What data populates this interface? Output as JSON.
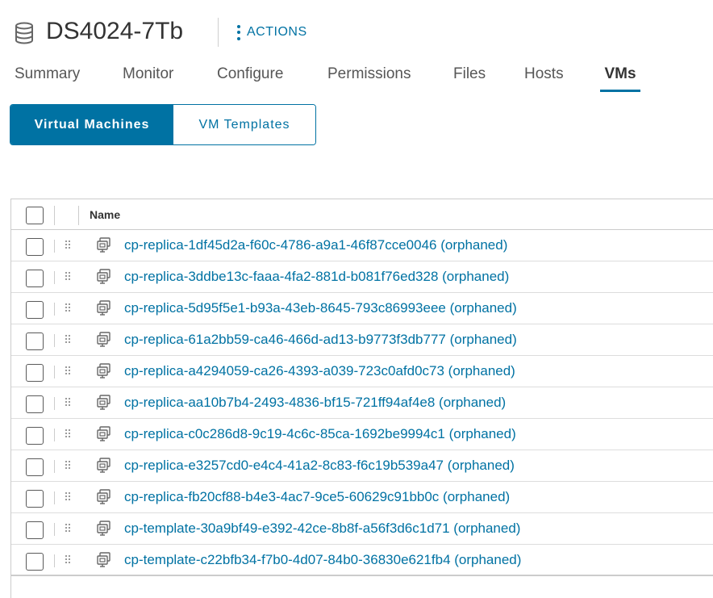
{
  "header": {
    "icon": "database-icon",
    "title": "DS4024-7Tb",
    "actions_icon": "kebab-icon",
    "actions_label": "ACTIONS"
  },
  "tabs": [
    {
      "label": "Summary",
      "active": false
    },
    {
      "label": "Monitor",
      "active": false
    },
    {
      "label": "Configure",
      "active": false
    },
    {
      "label": "Permissions",
      "active": false
    },
    {
      "label": "Files",
      "active": false
    },
    {
      "label": "Hosts",
      "active": false
    },
    {
      "label": "VMs",
      "active": true
    }
  ],
  "view_toggle": {
    "options": [
      "Virtual Machines",
      "VM Templates"
    ],
    "selected": "Virtual Machines"
  },
  "grid": {
    "columns": [
      "Name"
    ],
    "row_icon": "vm-icon",
    "rows": [
      {
        "name": "cp-replica-1df45d2a-f60c-4786-a9a1-46f87cce0046 (orphaned)"
      },
      {
        "name": "cp-replica-3ddbe13c-faaa-4fa2-881d-b081f76ed328 (orphaned)"
      },
      {
        "name": "cp-replica-5d95f5e1-b93a-43eb-8645-793c86993eee (orphaned)"
      },
      {
        "name": "cp-replica-61a2bb59-ca46-466d-ad13-b9773f3db777 (orphaned)"
      },
      {
        "name": "cp-replica-a4294059-ca26-4393-a039-723c0afd0c73 (orphaned)"
      },
      {
        "name": "cp-replica-aa10b7b4-2493-4836-bf15-721ff94af4e8 (orphaned)"
      },
      {
        "name": "cp-replica-c0c286d8-9c19-4c6c-85ca-1692be9994c1 (orphaned)"
      },
      {
        "name": "cp-replica-e3257cd0-e4c4-41a2-8c83-f6c19b539a47 (orphaned)"
      },
      {
        "name": "cp-replica-fb20cf88-b4e3-4ac7-9ce5-60629c91bb0c (orphaned)"
      },
      {
        "name": "cp-template-30a9bf49-e392-42ce-8b8f-a56f3d6c1d71 (orphaned)"
      },
      {
        "name": "cp-template-c22bfb34-f7b0-4d07-84b0-36830e621fb4 (orphaned)"
      }
    ]
  },
  "colors": {
    "accent": "#0072a3",
    "text": "#333333",
    "border": "#cccccc"
  }
}
